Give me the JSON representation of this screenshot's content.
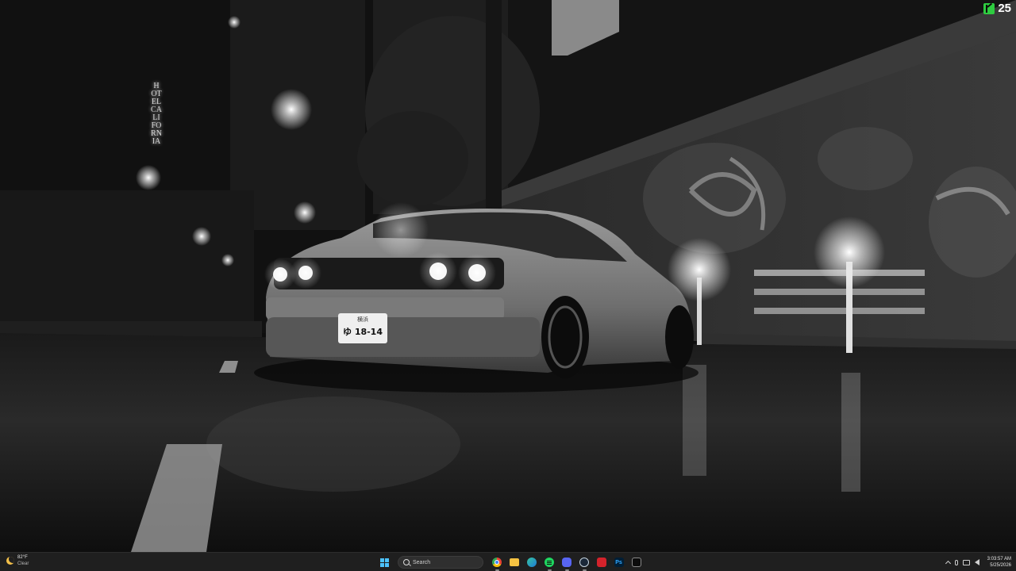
{
  "wallpaper": {
    "sign_text": "HOTEL CALIFORNIA",
    "plate_region": "横浜",
    "plate_number": "ゆ 18-14"
  },
  "overlay_widget": {
    "icon": "k-icon",
    "value": "25",
    "accent": "#2ecc40"
  },
  "taskbar": {
    "weather": {
      "temp": "82°F",
      "condition": "Clear",
      "icon": "moon-icon"
    },
    "search_placeholder": "Search",
    "pinned_apps": [
      {
        "name": "Start",
        "icon": "windows-icon"
      },
      {
        "name": "Chrome",
        "icon": "chrome-icon"
      },
      {
        "name": "File Explorer",
        "icon": "folder-icon"
      },
      {
        "name": "Edge",
        "icon": "edge-icon"
      },
      {
        "name": "Spotify",
        "icon": "spotify-icon"
      },
      {
        "name": "Discord",
        "icon": "discord-icon"
      },
      {
        "name": "Steam",
        "icon": "steam-icon"
      },
      {
        "name": "Acrobat",
        "icon": "acrobat-icon"
      },
      {
        "name": "Photoshop",
        "icon": "photoshop-icon",
        "label": "Ps"
      },
      {
        "name": "Terminal",
        "icon": "terminal-icon"
      }
    ],
    "clock": {
      "time": "3:03:57 AM",
      "date": "5/25/2026"
    }
  }
}
